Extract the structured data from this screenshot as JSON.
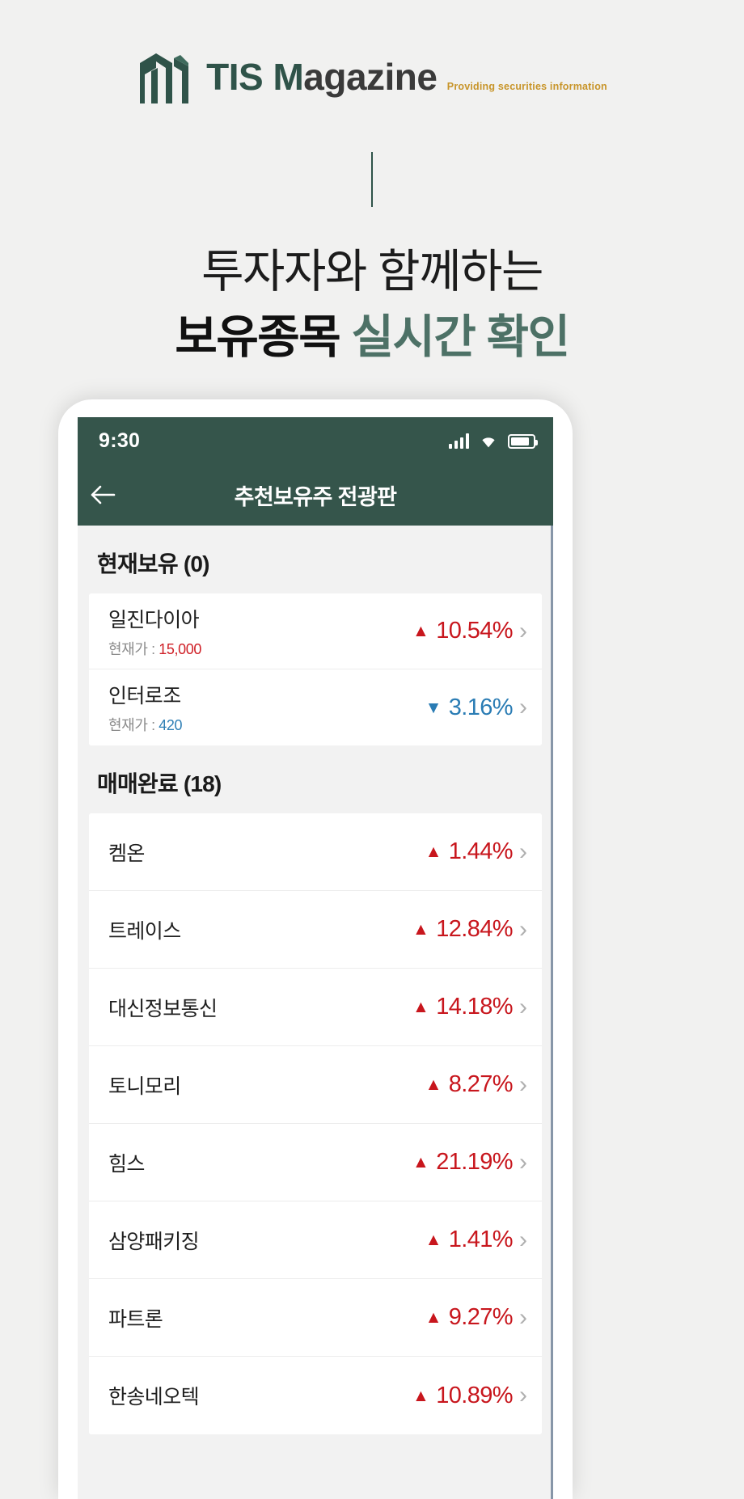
{
  "brand": {
    "logo_icon": "tis-building-logo",
    "name_part1": "TIS",
    "name_part2_m": "M",
    "name_part2_rest": "agazine",
    "tagline": "Providing securities information",
    "green": "#2f5349",
    "gold": "#c8952a"
  },
  "hero": {
    "line1": "투자자와 함께하는",
    "line2_dark": "보유종목",
    "line2_green": "실시간 확인"
  },
  "phone": {
    "status": {
      "time": "9:30",
      "signal_icon": "cellular-signal-icon",
      "wifi_icon": "wifi-icon",
      "battery_icon": "battery-icon"
    },
    "appbar": {
      "back_icon": "back-arrow-icon",
      "title": "추천보유주 전광판"
    },
    "sections": [
      {
        "title": "현재보유 (0)",
        "rows": [
          {
            "name": "일진다이아",
            "price_label": "현재가 :",
            "price_value": "15,000",
            "direction": "up",
            "triangle": "▲",
            "percent": "10.54%",
            "chevron": "chevron-right-icon"
          },
          {
            "name": "인터로조",
            "price_label": "현재가 :",
            "price_value": "420",
            "direction": "down",
            "triangle": "▼",
            "percent": "3.16%",
            "chevron": "chevron-right-icon"
          }
        ]
      },
      {
        "title": "매매완료 (18)",
        "rows": [
          {
            "name": "켐온",
            "direction": "up",
            "triangle": "▲",
            "percent": "1.44%",
            "chevron": "chevron-right-icon"
          },
          {
            "name": "트레이스",
            "direction": "up",
            "triangle": "▲",
            "percent": "12.84%",
            "chevron": "chevron-right-icon"
          },
          {
            "name": "대신정보통신",
            "direction": "up",
            "triangle": "▲",
            "percent": "14.18%",
            "chevron": "chevron-right-icon"
          },
          {
            "name": "토니모리",
            "direction": "up",
            "triangle": "▲",
            "percent": "8.27%",
            "chevron": "chevron-right-icon"
          },
          {
            "name": "힘스",
            "direction": "up",
            "triangle": "▲",
            "percent": "21.19%",
            "chevron": "chevron-right-icon"
          },
          {
            "name": "삼양패키징",
            "direction": "up",
            "triangle": "▲",
            "percent": "1.41%",
            "chevron": "chevron-right-icon"
          },
          {
            "name": "파트론",
            "direction": "up",
            "triangle": "▲",
            "percent": "9.27%",
            "chevron": "chevron-right-icon"
          },
          {
            "name": "한송네오텍",
            "direction": "up",
            "triangle": "▲",
            "percent": "10.89%",
            "chevron": "chevron-right-icon"
          }
        ]
      }
    ]
  },
  "colors": {
    "header_green": "#35554b",
    "up_red": "#c8161d",
    "down_blue": "#2a7cb4",
    "page_bg": "#f1f1f0"
  }
}
